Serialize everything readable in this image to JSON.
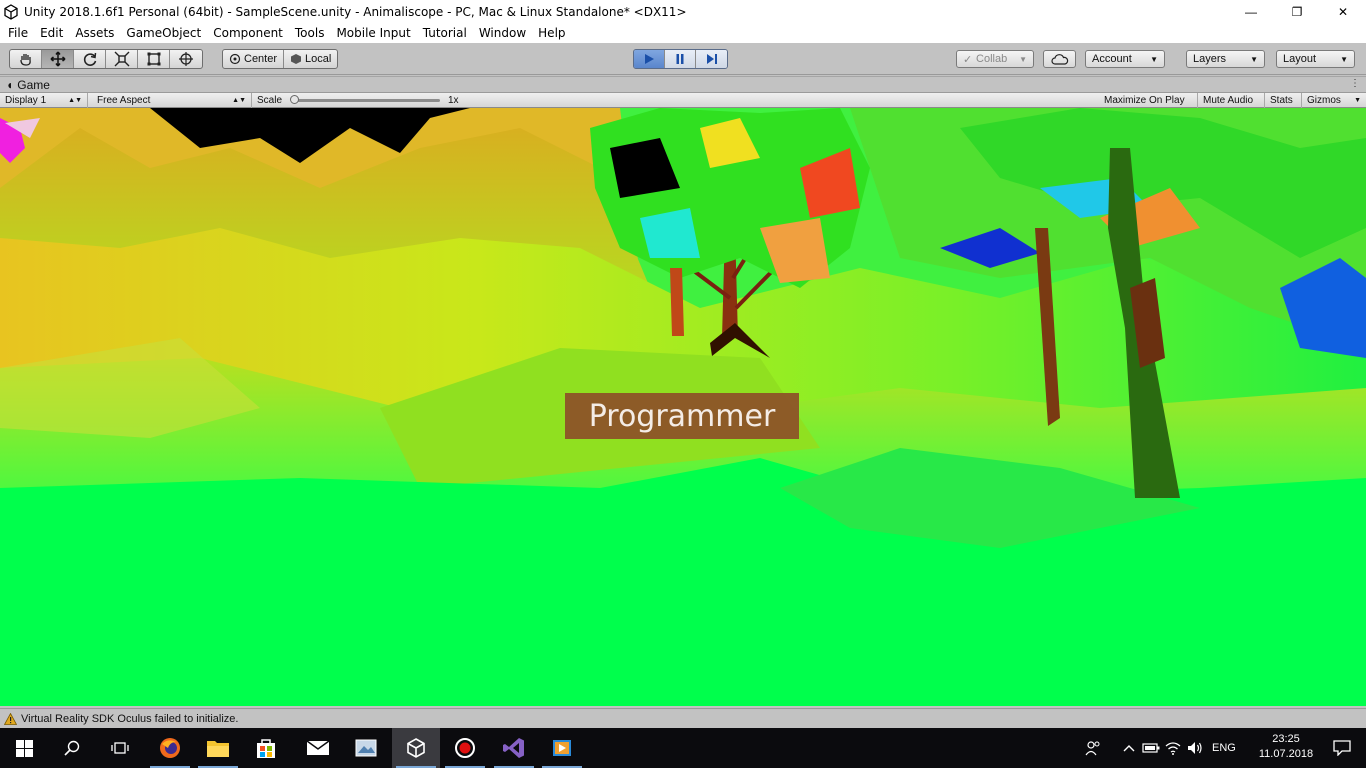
{
  "window": {
    "title": "Unity 2018.1.6f1 Personal (64bit) - SampleScene.unity - Animaliscope - PC, Mac & Linux Standalone* <DX11>",
    "minimize": "—",
    "restore": "❐",
    "close": "✕"
  },
  "menu": {
    "items": [
      "File",
      "Edit",
      "Assets",
      "GameObject",
      "Component",
      "Tools",
      "Mobile Input",
      "Tutorial",
      "Window",
      "Help"
    ]
  },
  "toolbar": {
    "tools": [
      "hand-tool",
      "move-tool",
      "rotate-tool",
      "scale-tool",
      "rect-tool",
      "transform-tool"
    ],
    "pivot_label": "Center",
    "space_label": "Local",
    "collab_label": "Collab",
    "account_label": "Account",
    "layers_label": "Layers",
    "layout_label": "Layout"
  },
  "game_panel": {
    "tab_label": "Game",
    "display": "Display 1",
    "aspect": "Free Aspect",
    "scale_label": "Scale",
    "scale_value": "1x",
    "scale_fraction": 0.0,
    "maximize_on_play": "Maximize On Play",
    "mute_audio": "Mute Audio",
    "stats": "Stats",
    "gizmos": "Gizmos",
    "overlay_text": "Programmer"
  },
  "status": {
    "message": "Virtual Reality SDK Oculus failed to initialize."
  },
  "taskbar": {
    "language": "ENG",
    "time": "23:25",
    "date": "11.07.2018"
  },
  "colors": {
    "accent_play": "#5a86cc",
    "label_bg": "#8c4828",
    "ground": "#00ff4c"
  }
}
